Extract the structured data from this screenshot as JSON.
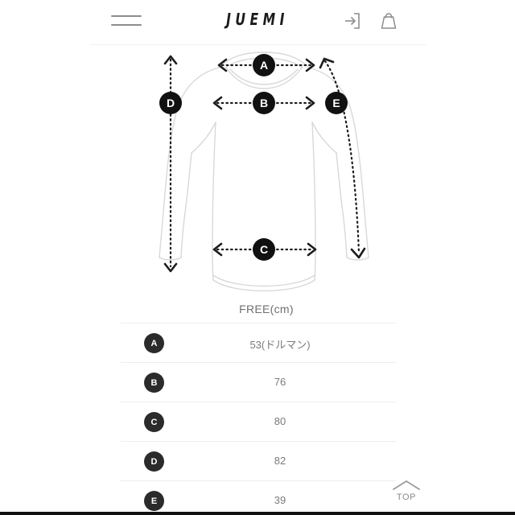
{
  "header": {
    "brand": "JUEMI",
    "menu_icon": "hamburger-menu-icon",
    "login_icon": "login-enter-icon",
    "bag_icon": "shopping-bag-icon"
  },
  "diagram": {
    "title": "long-sleeve-top-measurement-diagram",
    "markers": [
      {
        "id": "A",
        "label": "A",
        "name": "shoulder-width-marker"
      },
      {
        "id": "B",
        "label": "B",
        "name": "bust-width-marker"
      },
      {
        "id": "C",
        "label": "C",
        "name": "hem-width-marker"
      },
      {
        "id": "D",
        "label": "D",
        "name": "total-length-marker"
      },
      {
        "id": "E",
        "label": "E",
        "name": "sleeve-length-marker"
      }
    ]
  },
  "size_table": {
    "column_header": "FREE(cm)",
    "rows": [
      {
        "code": "A",
        "value": "53(ドルマン)"
      },
      {
        "code": "B",
        "value": "76"
      },
      {
        "code": "C",
        "value": "80"
      },
      {
        "code": "D",
        "value": "82"
      },
      {
        "code": "E",
        "value": "39"
      }
    ]
  },
  "scroll_top": {
    "label": "TOP",
    "icon": "chevron-up-icon"
  },
  "colors": {
    "badge": "#2b2b2b",
    "text_muted": "#7a7a7a",
    "rule": "#eeeeee",
    "garment_outline": "#d6d6d6"
  }
}
